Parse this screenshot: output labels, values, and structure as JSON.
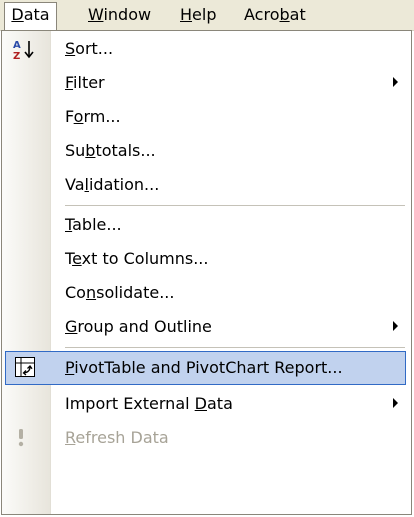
{
  "menubar": {
    "items": [
      {
        "pre": "",
        "mn": "D",
        "post": "ata"
      },
      {
        "pre": "",
        "mn": "W",
        "post": "indow"
      },
      {
        "pre": "",
        "mn": "H",
        "post": "elp"
      },
      {
        "pre": "Acro",
        "mn": "b",
        "post": "at"
      }
    ]
  },
  "menu": {
    "items": [
      {
        "pre": "",
        "mn": "S",
        "post": "ort..."
      },
      {
        "pre": "",
        "mn": "F",
        "post": "ilter"
      },
      {
        "pre": "F",
        "mn": "o",
        "post": "rm..."
      },
      {
        "pre": "Su",
        "mn": "b",
        "post": "totals..."
      },
      {
        "pre": "Va",
        "mn": "l",
        "post": "idation..."
      },
      {
        "pre": "",
        "mn": "T",
        "post": "able..."
      },
      {
        "pre": "T",
        "mn": "e",
        "post": "xt to Columns..."
      },
      {
        "pre": "Co",
        "mn": "n",
        "post": "solidate..."
      },
      {
        "pre": "",
        "mn": "G",
        "post": "roup and Outline"
      },
      {
        "pre": "",
        "mn": "P",
        "post": "ivotTable and PivotChart Report..."
      },
      {
        "pre": "Import External ",
        "mn": "D",
        "post": "ata"
      },
      {
        "pre": "",
        "mn": "R",
        "post": "efresh Data"
      }
    ]
  },
  "icons": {
    "sort": "sort-ascending-icon",
    "pivot": "pivottable-icon",
    "refresh": "refresh-icon",
    "submenu": "submenu-arrow-icon"
  },
  "colors": {
    "menubar": "#ece9d8",
    "highlight_fill": "#c1d2ee",
    "highlight_border": "#316ac5",
    "disabled_text": "#a7a397"
  }
}
